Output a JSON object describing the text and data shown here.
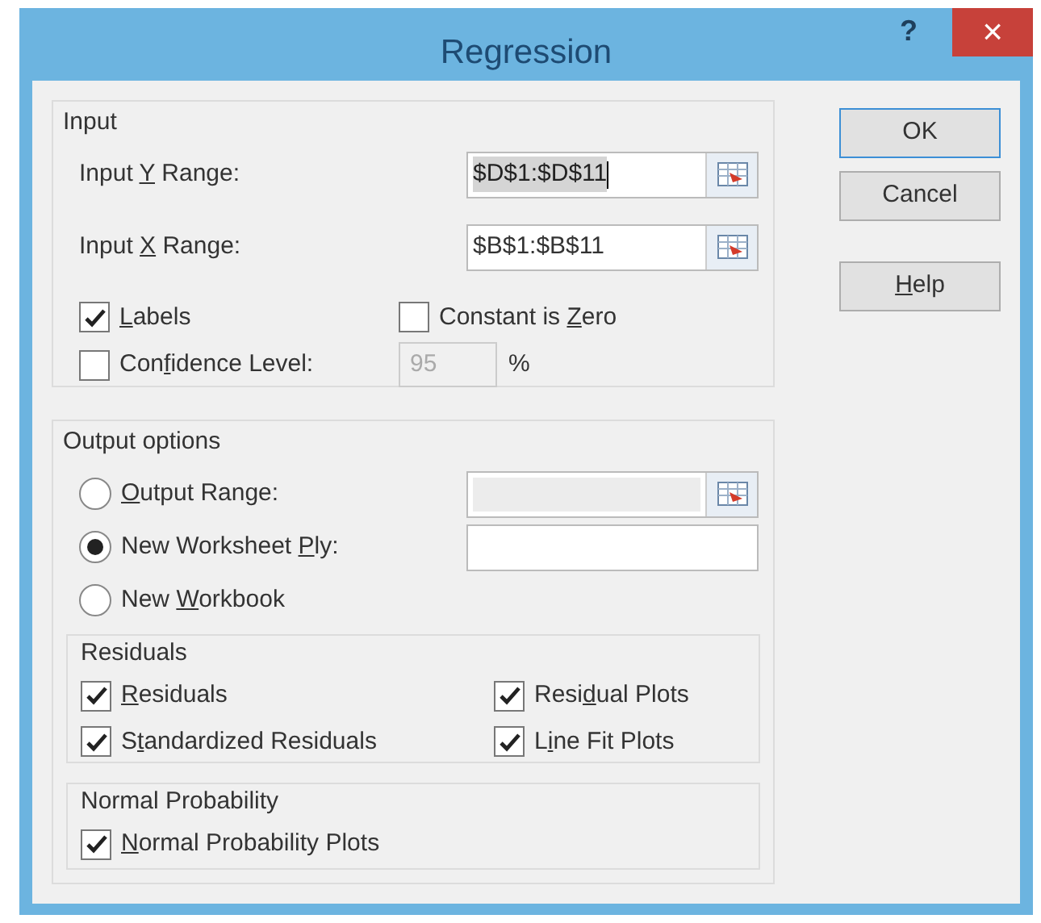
{
  "window": {
    "title": "Regression",
    "help": "?",
    "close": "×"
  },
  "input": {
    "title": "Input",
    "ranges": [
      {
        "label": {
          "before": "Input ",
          "key": "Y",
          "after": " Range:"
        },
        "value": "$D$1:$D$11",
        "selected": true
      },
      {
        "label": {
          "before": "Input ",
          "key": "X",
          "after": " Range:"
        },
        "value": "$B$1:$B$11",
        "selected": false
      }
    ],
    "labels": {
      "label": {
        "key": "L",
        "after": "abels"
      },
      "checked": true
    },
    "constant_is_zero": {
      "label": {
        "before": "Constant is ",
        "key": "Z",
        "after": "ero"
      },
      "checked": false
    },
    "confidence": {
      "label": {
        "before": "Con",
        "key": "f",
        "after": "idence Level:"
      },
      "checked": false,
      "value": "95",
      "disabled": true,
      "unit": "%"
    }
  },
  "buttons": [
    {
      "label": {
        "before": "OK"
      },
      "default": true
    },
    {
      "label": {
        "before": "Cancel"
      },
      "default": false
    },
    {
      "label": {
        "key": "H",
        "after": "elp"
      },
      "default": false
    }
  ],
  "output": {
    "title": "Output options",
    "destinations": [
      {
        "label": {
          "key": "O",
          "after": "utput Range:"
        },
        "selected": false,
        "kind": "picker",
        "disabled": true
      },
      {
        "label": {
          "before": "New Worksheet ",
          "key": "P",
          "after": "ly:"
        },
        "selected": true,
        "kind": "text",
        "disabled": false
      },
      {
        "label": {
          "before": "New ",
          "key": "W",
          "after": "orkbook"
        },
        "selected": false
      }
    ],
    "residuals": {
      "title": "Residuals",
      "items": [
        {
          "label": {
            "key": "R",
            "after": "esiduals"
          },
          "checked": true
        },
        {
          "label": {
            "before": "Resi",
            "key": "d",
            "after": "ual Plots"
          },
          "checked": true
        },
        {
          "label": {
            "before": "S",
            "key": "t",
            "after": "andardized Residuals"
          },
          "checked": true
        },
        {
          "label": {
            "before": "L",
            "key": "i",
            "after": "ne Fit Plots"
          },
          "checked": true
        }
      ]
    },
    "normal_probability": {
      "title": "Normal Probability",
      "items": [
        {
          "label": {
            "key": "N",
            "after": "ormal Probability Plots"
          },
          "checked": true
        }
      ]
    }
  }
}
